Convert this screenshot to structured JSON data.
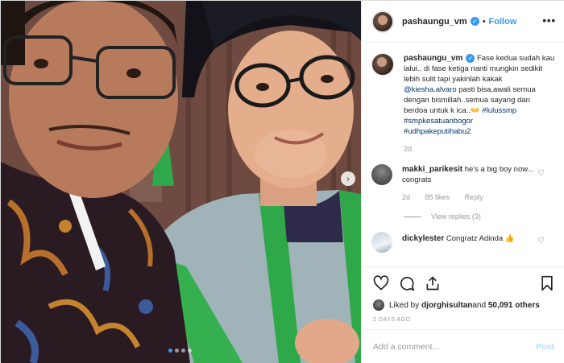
{
  "post": {
    "username": "pashaungu_vm",
    "follow_label": "Follow",
    "separator": "•",
    "more_label": "•••"
  },
  "caption": {
    "username": "pashaungu_vm",
    "text_1": " Fase kedua sudah kau lalui.. di fase ketiga nanti mungkin sedikit lebih sulit tapi yakinlah kakak ",
    "mention": "@kiesha.alvaro",
    "text_2": " pasti bisa,awali semua dengan bismillah..semua sayang dan berdoa untuk k ica..",
    "emoji": "👐",
    "hashtag_1": "#lulussmp",
    "hashtag_2": "#smpkesatuanbogor",
    "hashtag_3": "#udhpakeputihabu2",
    "time": "2d"
  },
  "comments": [
    {
      "username": "makki_parikesit",
      "text": " he's a big boy now... congrats",
      "time": "2d",
      "likes": "85 likes",
      "reply_label": "Reply",
      "view_replies": "View replies (3)"
    },
    {
      "username": "dickylester",
      "text": " Congratz Adinda ",
      "emoji": "👍"
    }
  ],
  "likes": {
    "prefix": "Liked by ",
    "user": "djorghisultan",
    "middle": " and ",
    "count": "50,091 others"
  },
  "timestamp": "2 DAYS AGO",
  "add_comment": {
    "placeholder": "Add a comment...",
    "post_label": "Post"
  },
  "icons": {
    "heart": "heart-icon",
    "comment": "comment-icon",
    "share": "share-icon",
    "bookmark": "bookmark-icon",
    "verified": "verified-badge-icon",
    "next": "chevron-right-icon"
  },
  "colors": {
    "accent": "#3897f0",
    "text": "#262626",
    "muted": "#999999",
    "link": "#003569",
    "post_disabled": "#b2dffc"
  },
  "carousel": {
    "total": 4,
    "active": 1
  }
}
